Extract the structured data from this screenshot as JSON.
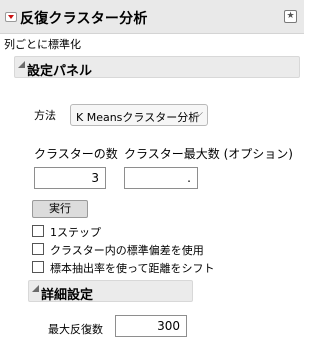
{
  "header": {
    "title": "反復クラスター分析",
    "menu_icon": "red-triangle-menu-icon",
    "pin_icon": "star-icon"
  },
  "subtitle": "列ごとに標準化",
  "settings_panel": {
    "title": "設定パネル",
    "method_label": "方法",
    "method_value": "K Meansクラスター分析",
    "cluster_count_label": "クラスターの数",
    "cluster_count_value": "3",
    "max_clusters_label": "クラスター最大数 (オプション)",
    "max_clusters_value": ".",
    "run_button": "実行",
    "checkboxes": [
      {
        "label": "1ステップ",
        "checked": false
      },
      {
        "label": "クラスター内の標準偏差を使用",
        "checked": false
      },
      {
        "label": "標本抽出率を使って距離をシフト",
        "checked": false
      }
    ]
  },
  "advanced": {
    "title": "詳細設定",
    "max_iter_label": "最大反復数",
    "max_iter_value": "300"
  },
  "colors": {
    "menu_red": "#cc1111",
    "panel_bg": "#ebebeb"
  }
}
